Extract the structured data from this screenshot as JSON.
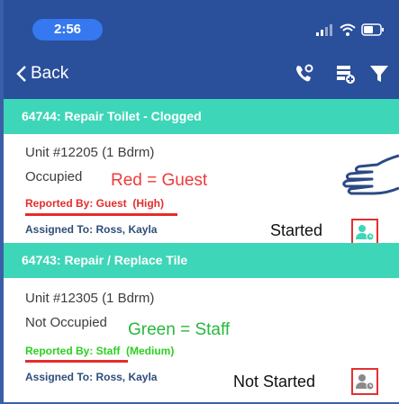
{
  "status_bar": {
    "time": "2:56"
  },
  "nav": {
    "back_label": "Back",
    "icons": [
      "phone-settings-icon",
      "add-list-icon",
      "filter-icon"
    ]
  },
  "work_orders": [
    {
      "banner": "64744: Repair Toilet - Clogged",
      "unit": "Unit #12205 (1 Bdrm)",
      "occupancy": "Occupied",
      "reported_by": "Reported By: Guest",
      "priority": "(High)",
      "reported_color": "#e52c2c",
      "assigned": "Assigned To: Ross, Kayla",
      "status": "Started",
      "status_icon_color": "#3ed6b8",
      "annotation": "Red = Guest",
      "annotation_color": "#ee3a3a"
    },
    {
      "banner": "64743: Repair / Replace Tile",
      "unit": "Unit #12305 (1 Bdrm)",
      "occupancy": "Not Occupied",
      "reported_by": "Reported By: Staff",
      "priority": "(Medium)",
      "reported_color": "#2bd11f",
      "assigned": "Assigned To: Ross, Kayla",
      "status": "Not Started",
      "status_icon_color": "#8a8a8a",
      "annotation": "Green = Staff",
      "annotation_color": "#28b83c"
    }
  ]
}
